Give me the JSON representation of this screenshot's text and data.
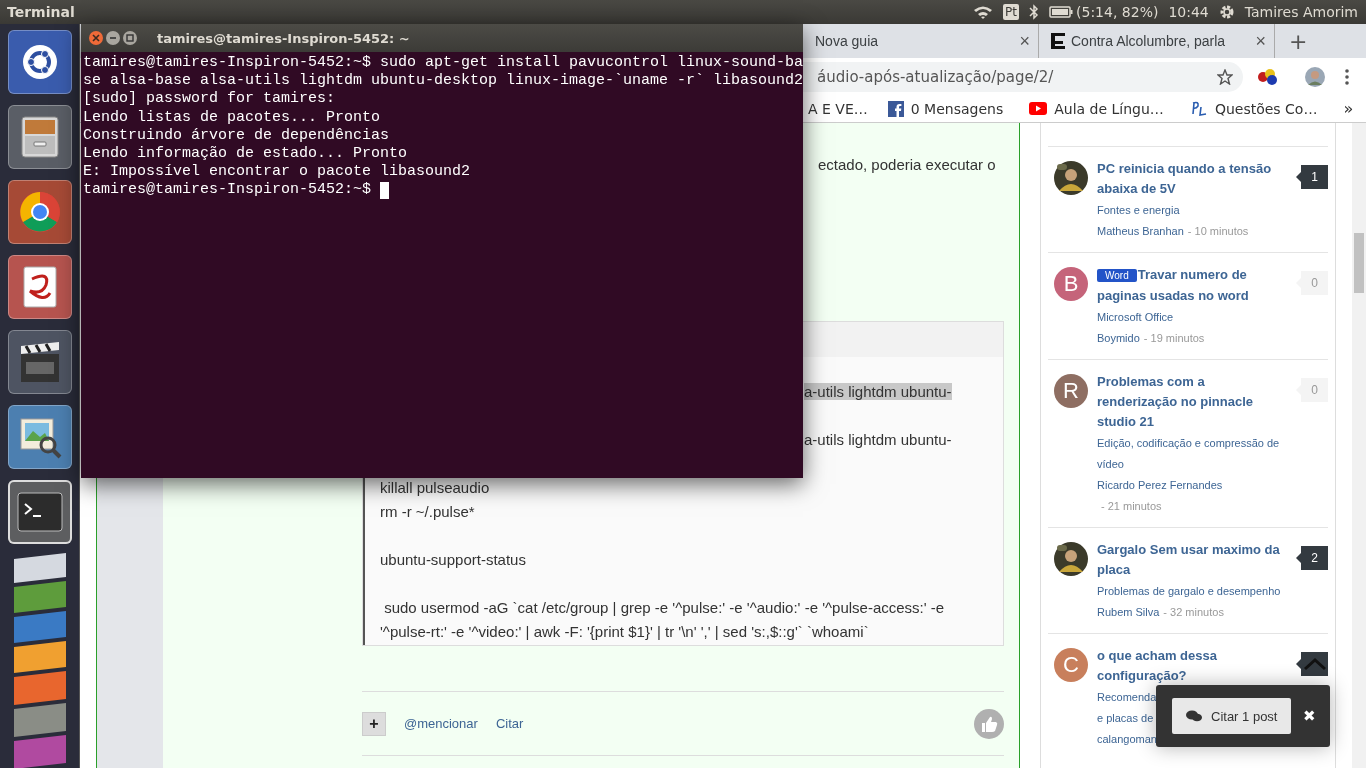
{
  "top_panel": {
    "app_title": "Terminal",
    "keyboard": "Pt",
    "battery": "(5:14, 82%)",
    "clock": "10:44",
    "user": "Tamires Amorim"
  },
  "terminal": {
    "title": "tamires@tamires-Inspiron-5452: ~",
    "lines": [
      "tamires@tamires-Inspiron-5452:~$ sudo apt-get install pavucontrol linux-sound-ba",
      "se alsa-base alsa-utils lightdm ubuntu-desktop linux-image-`uname -r` libasound2",
      "[sudo] password for tamires:",
      "Lendo listas de pacotes... Pronto",
      "Construindo árvore de dependências",
      "Lendo informação de estado... Pronto",
      "E: Impossível encontrar o pacote libasound2"
    ],
    "prompt": "tamires@tamires-Inspiron-5452:~$"
  },
  "browser": {
    "tabs": [
      {
        "label": "Nova guia",
        "selected": false,
        "close": "×"
      },
      {
        "label": "Contra Alcolumbre, parla",
        "selected": false,
        "close": "×"
      }
    ],
    "new_tab": "+",
    "address": "áudio-após-atualização/page/2/",
    "bookmarks": [
      {
        "kind": "plain",
        "label": "A E VE…"
      },
      {
        "kind": "facebook",
        "label": "0 Mensagens"
      },
      {
        "kind": "youtube",
        "label": "Aula de Língu…"
      },
      {
        "kind": "site",
        "label": "Questões Co…"
      }
    ],
    "bookmarks_more": "»"
  },
  "post": {
    "text_fragment": "ectado, poderia executar o",
    "code_paragraphs": [
      {
        "lines": [
          {
            "kind": "continued",
            "text": "a-utils lightdm ubuntu-",
            "highlighted": true
          }
        ]
      },
      {
        "lines": [
          {
            "kind": "continued",
            "text": "a-utils lightdm ubuntu-",
            "highlighted": false
          }
        ]
      },
      {
        "lines": [
          {
            "kind": "full",
            "text": "killall pulseaudio",
            "highlighted": false
          },
          {
            "kind": "full",
            "text": "rm -r ~/.pulse*",
            "highlighted": false
          }
        ]
      },
      {
        "lines": [
          {
            "kind": "full",
            "text": "ubuntu-support-status",
            "highlighted": false
          }
        ]
      },
      {
        "lines": [
          {
            "kind": "full",
            "text": " sudo usermod -aG `cat /etc/group | grep -e '^pulse:' -e '^audio:' -e '^pulse-access:' -e '^pulse-rt:' -e '^video:' | awk -F: '{print $1}' | tr '\\n' ',' | sed 's:,$::g'` `whoami`",
            "highlighted": false
          }
        ]
      }
    ],
    "actions": {
      "plus": "+",
      "mention": "@mencionar",
      "quote": "Citar"
    }
  },
  "sidebar": [
    {
      "avatar": {
        "kind": "picture"
      },
      "title": "PC reinicia quando a tensão abaixa de 5V",
      "category_lines": [
        "Fontes e energia"
      ],
      "author": "Matheus Branhan",
      "time": "- 10 minutos",
      "count": "1",
      "has_replies": true
    },
    {
      "avatar": {
        "kind": "letter",
        "letter": "B",
        "color": "#c5647a"
      },
      "tag": "Word",
      "title": "Travar numero de paginas usadas no word",
      "category_lines": [
        "Microsoft Office"
      ],
      "author": "Boymido",
      "time": "- 19 minutos",
      "count": "0",
      "has_replies": false
    },
    {
      "avatar": {
        "kind": "letter",
        "letter": "R",
        "color": "#8e6e62"
      },
      "title": "Problemas com a renderização no pinnacle studio 21",
      "category_lines": [
        "Edição, codificação e compressão de vídeo"
      ],
      "author": "Ricardo Perez Fernandes",
      "time": "- 21 minutos",
      "count": "0",
      "has_replies": false
    },
    {
      "avatar": {
        "kind": "picture"
      },
      "title": "Gargalo Sem usar maximo da placa",
      "category_lines": [
        "Problemas de gargalo e desempenho"
      ],
      "author": "Rubem Silva",
      "time": "- 32 minutos",
      "count": "2",
      "has_replies": true
    },
    {
      "avatar": {
        "kind": "letter",
        "letter": "C",
        "color": "#c87f5c"
      },
      "title": "o que acham dessa configuração?",
      "category_lines": [
        "Recomenda",
        "e placas de"
      ],
      "author": "calangoman",
      "has_replies": true
    }
  ],
  "quote_popup": {
    "button": "Citar 1 post",
    "close": "✖"
  }
}
